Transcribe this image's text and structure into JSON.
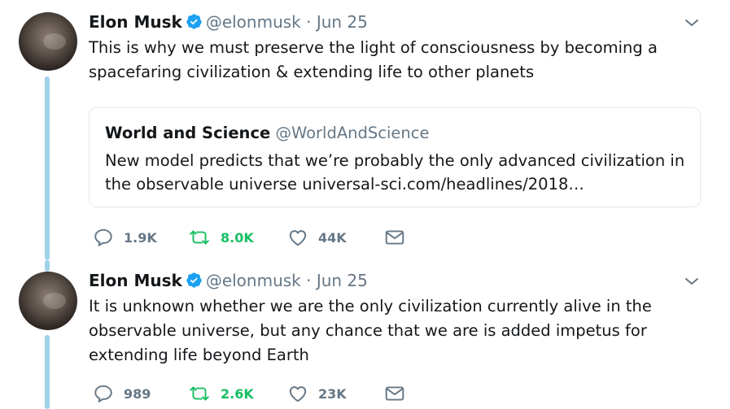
{
  "tweets": [
    {
      "author": {
        "name": "Elon Musk",
        "handle": "@elonmusk"
      },
      "separator": "·",
      "date": "Jun 25",
      "text": "This is why we must preserve the light of consciousness by becoming a spacefaring civilization & extending life to other planets",
      "quoted": {
        "name": "World and Science",
        "handle": "@WorldAndScience",
        "text": "New model predicts that we’re probably the only advanced civilization in the observable universe universal-sci.com/headlines/2018…"
      },
      "stats": {
        "replies": "1.9K",
        "retweets": "8.0K",
        "likes": "44K"
      }
    },
    {
      "author": {
        "name": "Elon Musk",
        "handle": "@elonmusk"
      },
      "separator": "·",
      "date": "Jun 25",
      "text": "It is unknown whether we are the only civilization currently alive in the observable universe, but any chance that we are is added impetus for extending life beyond Earth",
      "stats": {
        "replies": "989",
        "retweets": "2.6K",
        "likes": "23K"
      }
    }
  ],
  "colors": {
    "text": "#14171a",
    "secondary": "#657786",
    "verified": "#1da1f2",
    "retweet": "#17bf63",
    "thread_line": "#9fd3e9",
    "border": "#e1e8ed"
  },
  "icons": {
    "verified": "verified-badge-icon",
    "caret": "chevron-down-icon",
    "reply": "reply-icon",
    "retweet": "retweet-icon",
    "like": "heart-icon",
    "message": "envelope-icon"
  }
}
